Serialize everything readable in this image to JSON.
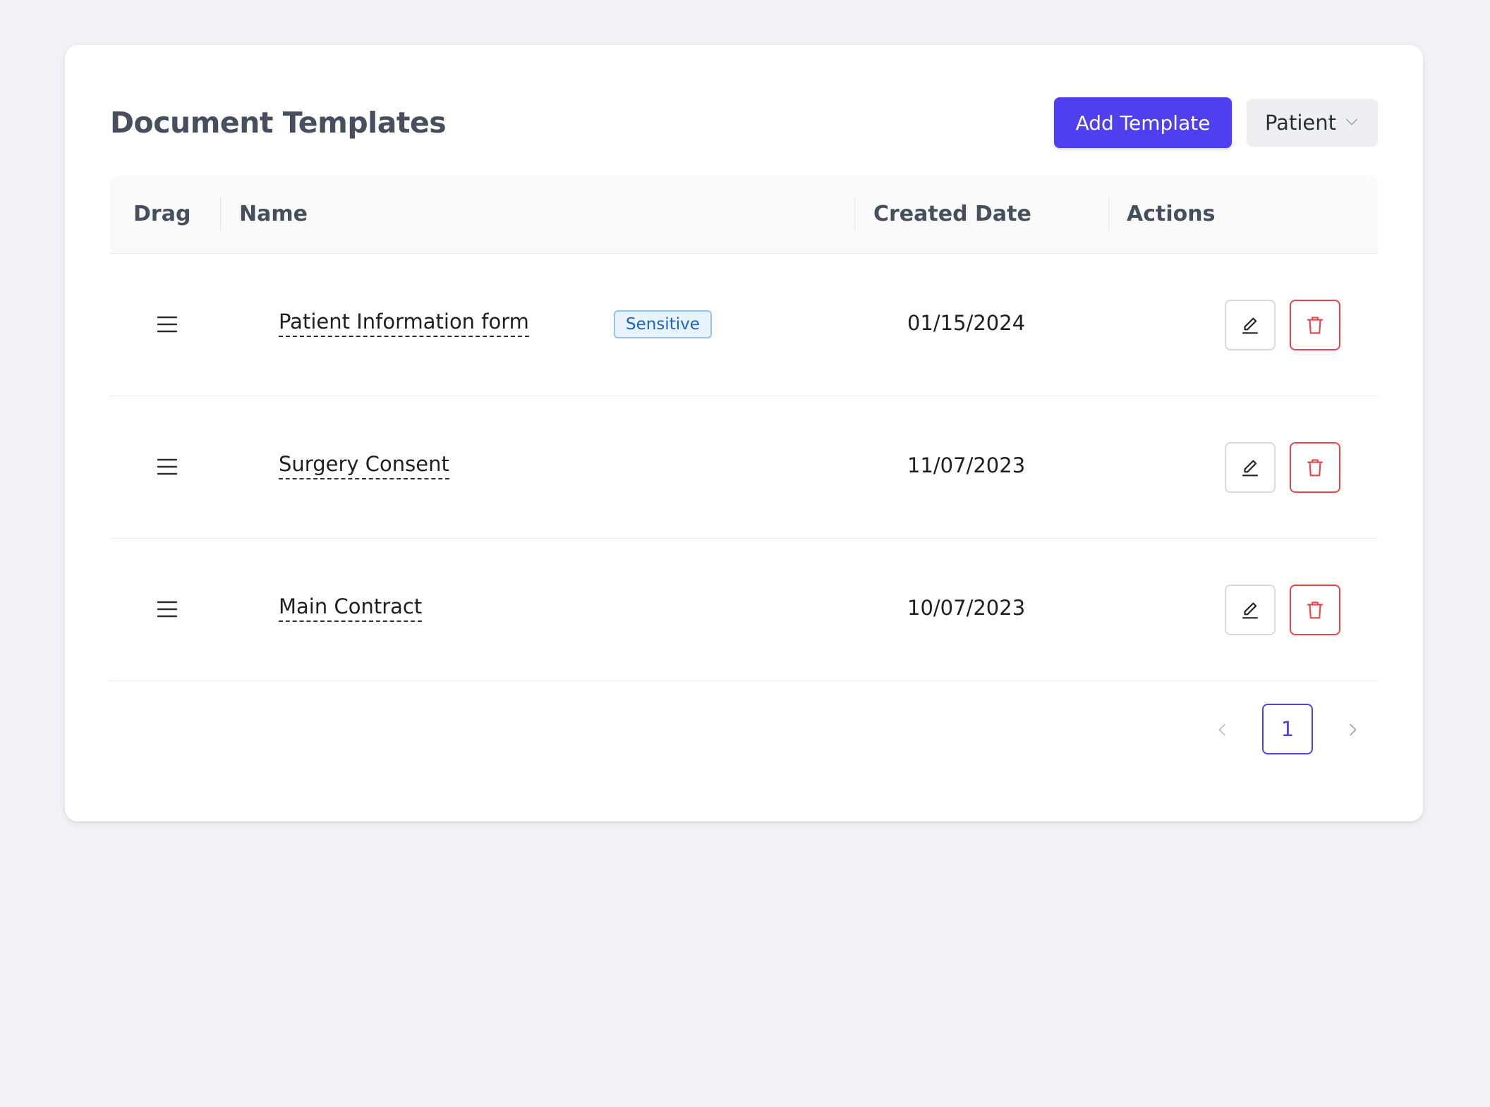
{
  "header": {
    "title": "Document Templates",
    "add_button_label": "Add Template",
    "filter_select": {
      "selected": "Patient"
    }
  },
  "table": {
    "columns": {
      "drag": "Drag",
      "name": "Name",
      "created_date": "Created Date",
      "actions": "Actions"
    },
    "rows": [
      {
        "name": "Patient Information form",
        "badge": "Sensitive",
        "created_date": "01/15/2024"
      },
      {
        "name": "Surgery Consent",
        "badge": "",
        "created_date": "11/07/2023"
      },
      {
        "name": "Main Contract",
        "badge": "",
        "created_date": "10/07/2023"
      }
    ],
    "row_icons": {
      "drag": "drag-handle-icon",
      "edit": "pencil-icon",
      "delete": "trash-icon"
    }
  },
  "pagination": {
    "current_page": "1",
    "prev_icon": "chevron-left-icon",
    "next_icon": "chevron-right-icon"
  },
  "colors": {
    "primary": "#4f3fef",
    "danger": "#e8454a",
    "badge_bg": "#e8f3ff",
    "badge_border": "#93c2f3",
    "badge_text": "#1c63c6",
    "page_bg": "#f1f2f5"
  }
}
